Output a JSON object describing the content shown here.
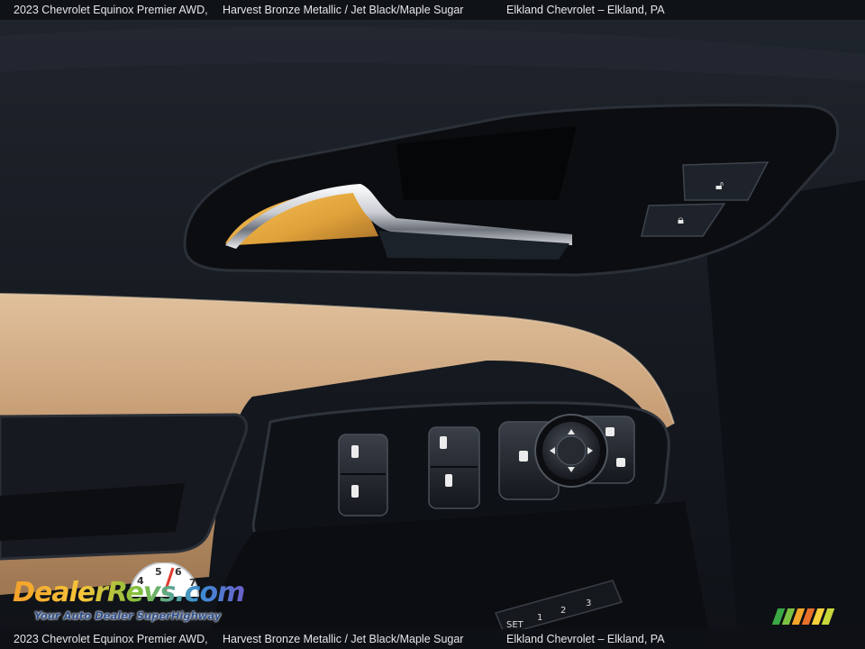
{
  "caption": {
    "vehicle": "2023 Chevrolet Equinox Premier AWD,",
    "colors": "Harvest Bronze Metallic / Jet Black/Maple Sugar",
    "dealer": "Elkland Chevrolet – Elkland, PA"
  },
  "watermark": {
    "brand": "DealerRevs.com",
    "tagline": "Your Auto Dealer SuperHighway"
  },
  "colors": {
    "door_black": "#14181f",
    "maple_sugar_tan": "#c9a27c",
    "chrome": "#dcdcdc"
  }
}
